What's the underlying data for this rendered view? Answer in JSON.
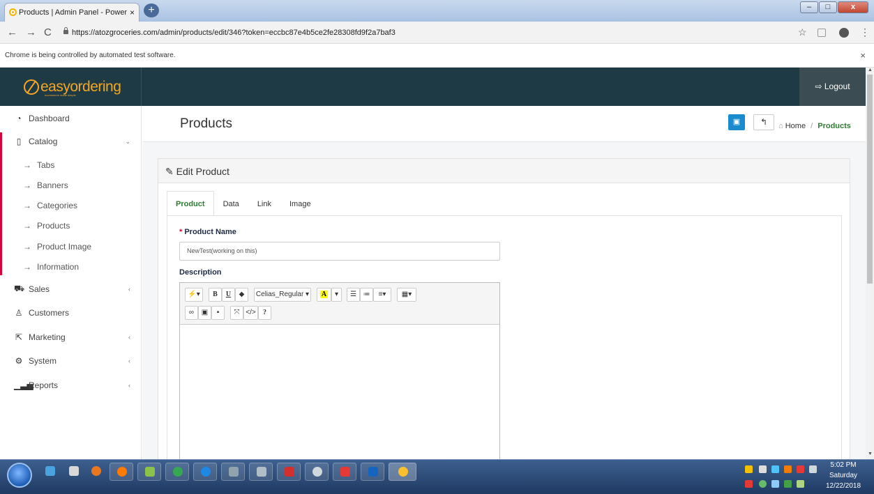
{
  "browser": {
    "tab_title": "Products | Admin Panel - Powere",
    "tab_close": "×",
    "new_tab": "+",
    "url": "https://atozgroceries.com/admin/products/edit/346?token=eccbc87e4b5ce2fe28308fd9f2a7baf3",
    "automation_notice": "Chrome is being controlled by automated test software.",
    "automation_close": "×"
  },
  "header": {
    "logo_text": "easyordering",
    "logo_tagline": "ecommerce made simple",
    "logout_label": "Logout",
    "logout_icon": "sign-out-icon"
  },
  "sidebar": {
    "items": [
      {
        "label": "Dashboard",
        "icon": "dashboard-icon"
      },
      {
        "label": "Catalog",
        "icon": "catalog-icon",
        "expanded": true
      },
      {
        "label": "Sales",
        "icon": "cart-icon"
      },
      {
        "label": "Customers",
        "icon": "user-icon"
      },
      {
        "label": "Marketing",
        "icon": "share-icon"
      },
      {
        "label": "System",
        "icon": "gear-icon"
      },
      {
        "label": "Reports",
        "icon": "bar-chart-icon"
      }
    ],
    "catalog_children": [
      "Tabs",
      "Banners",
      "Categories",
      "Products",
      "Product Image",
      "Information"
    ]
  },
  "page": {
    "title": "Products",
    "breadcrumb_home": "Home",
    "breadcrumb_sep": "/",
    "breadcrumb_current": "Products"
  },
  "panel": {
    "heading": "Edit Product",
    "tabs": [
      "Product",
      "Data",
      "Link",
      "Image"
    ],
    "active_tab": "Product",
    "product_name_label": "Product Name",
    "required_mark": "*",
    "product_name_value": "NewTest(working on this)",
    "description_label": "Description",
    "font_select": "Celias_Regular"
  },
  "taskbar": {
    "time": "5:02 PM",
    "day": "Saturday",
    "date": "12/22/2018"
  },
  "colors": {
    "header_bg": "#1e3a44",
    "logo_accent": "#f5a623",
    "active_green": "#2e7d32",
    "catalog_red": "#d9003b",
    "primary_blue": "#1a8ccd"
  }
}
